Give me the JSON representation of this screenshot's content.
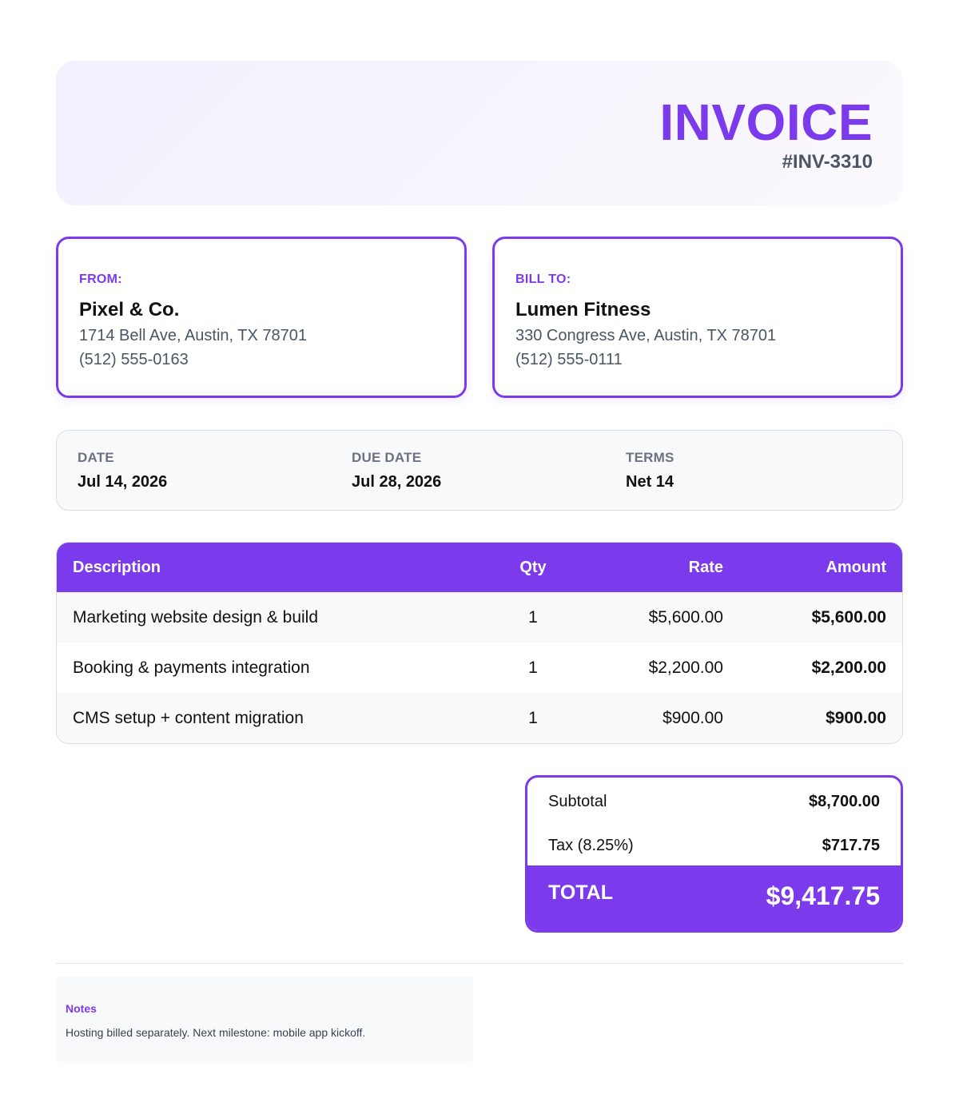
{
  "header": {
    "title": "INVOICE",
    "number": "#INV-3310"
  },
  "from": {
    "label": "FROM:",
    "name": "Pixel & Co.",
    "address": "1714 Bell Ave, Austin, TX 78701",
    "phone": "(512) 555-0163"
  },
  "bill_to": {
    "label": "BILL TO:",
    "name": "Lumen Fitness",
    "address": "330 Congress Ave, Austin, TX 78701",
    "phone": "(512) 555-0111"
  },
  "meta": {
    "date_label": "DATE",
    "date": "Jul 14, 2026",
    "due_label": "DUE DATE",
    "due": "Jul 28, 2026",
    "terms_label": "TERMS",
    "terms": "Net 14"
  },
  "items": {
    "columns": [
      "Description",
      "Qty",
      "Rate",
      "Amount"
    ],
    "rows": [
      {
        "description": "Marketing website design & build",
        "qty": "1",
        "rate": "$5,600.00",
        "amount": "$5,600.00"
      },
      {
        "description": "Booking & payments integration",
        "qty": "1",
        "rate": "$2,200.00",
        "amount": "$2,200.00"
      },
      {
        "description": "CMS setup + content migration",
        "qty": "1",
        "rate": "$900.00",
        "amount": "$900.00"
      }
    ]
  },
  "totals": {
    "subtotal_label": "Subtotal",
    "subtotal": "$8,700.00",
    "tax_label": "Tax (8.25%)",
    "tax": "$717.75",
    "total_label": "TOTAL",
    "total": "$9,417.75"
  },
  "notes": {
    "label": "Notes",
    "text": "Hosting billed separately. Next milestone: mobile app kickoff."
  },
  "colors": {
    "accent": "#7c3aed",
    "muted": "#6b7280",
    "panel": "#f8f9fb"
  }
}
